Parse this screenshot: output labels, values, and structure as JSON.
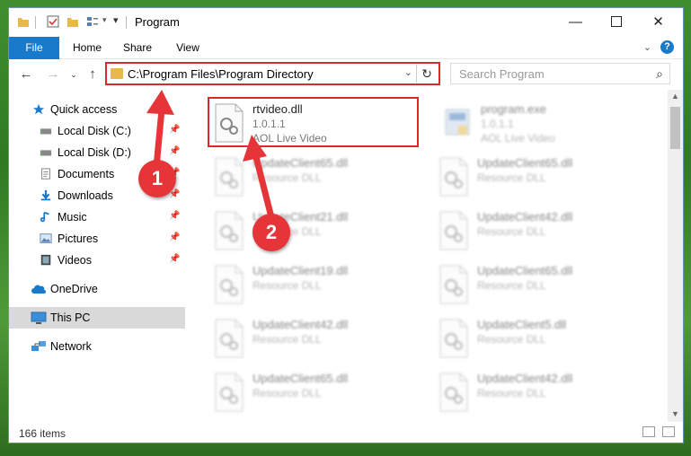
{
  "window": {
    "title": "Program",
    "tabs": [
      "File",
      "Home",
      "Share",
      "View"
    ]
  },
  "address": {
    "path": "C:\\Program Files\\Program Directory"
  },
  "search": {
    "placeholder": "Search Program"
  },
  "sidebar": {
    "quick_access": "Quick access",
    "items": [
      {
        "label": "Local Disk (C:)",
        "icon": "drive-icon",
        "pinned": true
      },
      {
        "label": "Local Disk (D:)",
        "icon": "drive-icon",
        "pinned": true
      },
      {
        "label": "Documents",
        "icon": "documents-icon",
        "pinned": true
      },
      {
        "label": "Downloads",
        "icon": "downloads-icon",
        "pinned": true
      },
      {
        "label": "Music",
        "icon": "music-icon",
        "pinned": true
      },
      {
        "label": "Pictures",
        "icon": "pictures-icon",
        "pinned": true
      },
      {
        "label": "Videos",
        "icon": "videos-icon",
        "pinned": true
      }
    ],
    "onedrive": "OneDrive",
    "this_pc": "This PC",
    "network": "Network"
  },
  "files": {
    "highlighted": {
      "name": "rtvideo.dll",
      "version": "1.0.1.1",
      "description": "AOL Live Video"
    },
    "program_exe": {
      "name": "program.exe",
      "version": "1.0.1.1",
      "description": "AOL Live Video"
    },
    "left_column": [
      {
        "name": "UpdateClient65.dll",
        "type": "Resource DLL"
      },
      {
        "name": "UpdateClient21.dll",
        "type": "Resource DLL"
      },
      {
        "name": "UpdateClient19.dll",
        "type": "Resource DLL"
      },
      {
        "name": "UpdateClient42.dll",
        "type": "Resource DLL"
      },
      {
        "name": "UpdateClient65.dll",
        "type": "Resource DLL"
      }
    ],
    "right_column": [
      {
        "name": "UpdateClient65.dll",
        "type": "Resource DLL"
      },
      {
        "name": "UpdateClient42.dll",
        "type": "Resource DLL"
      },
      {
        "name": "UpdateClient65.dll",
        "type": "Resource DLL"
      },
      {
        "name": "UpdateClient5.dll",
        "type": "Resource DLL"
      },
      {
        "name": "UpdateClient42.dll",
        "type": "Resource DLL"
      }
    ]
  },
  "status": {
    "item_count": "166 items"
  },
  "annotations": {
    "step1": "1",
    "step2": "2",
    "color": "#e63539"
  },
  "colors": {
    "accent": "#1979ca",
    "highlight_border": "#e0262d"
  }
}
